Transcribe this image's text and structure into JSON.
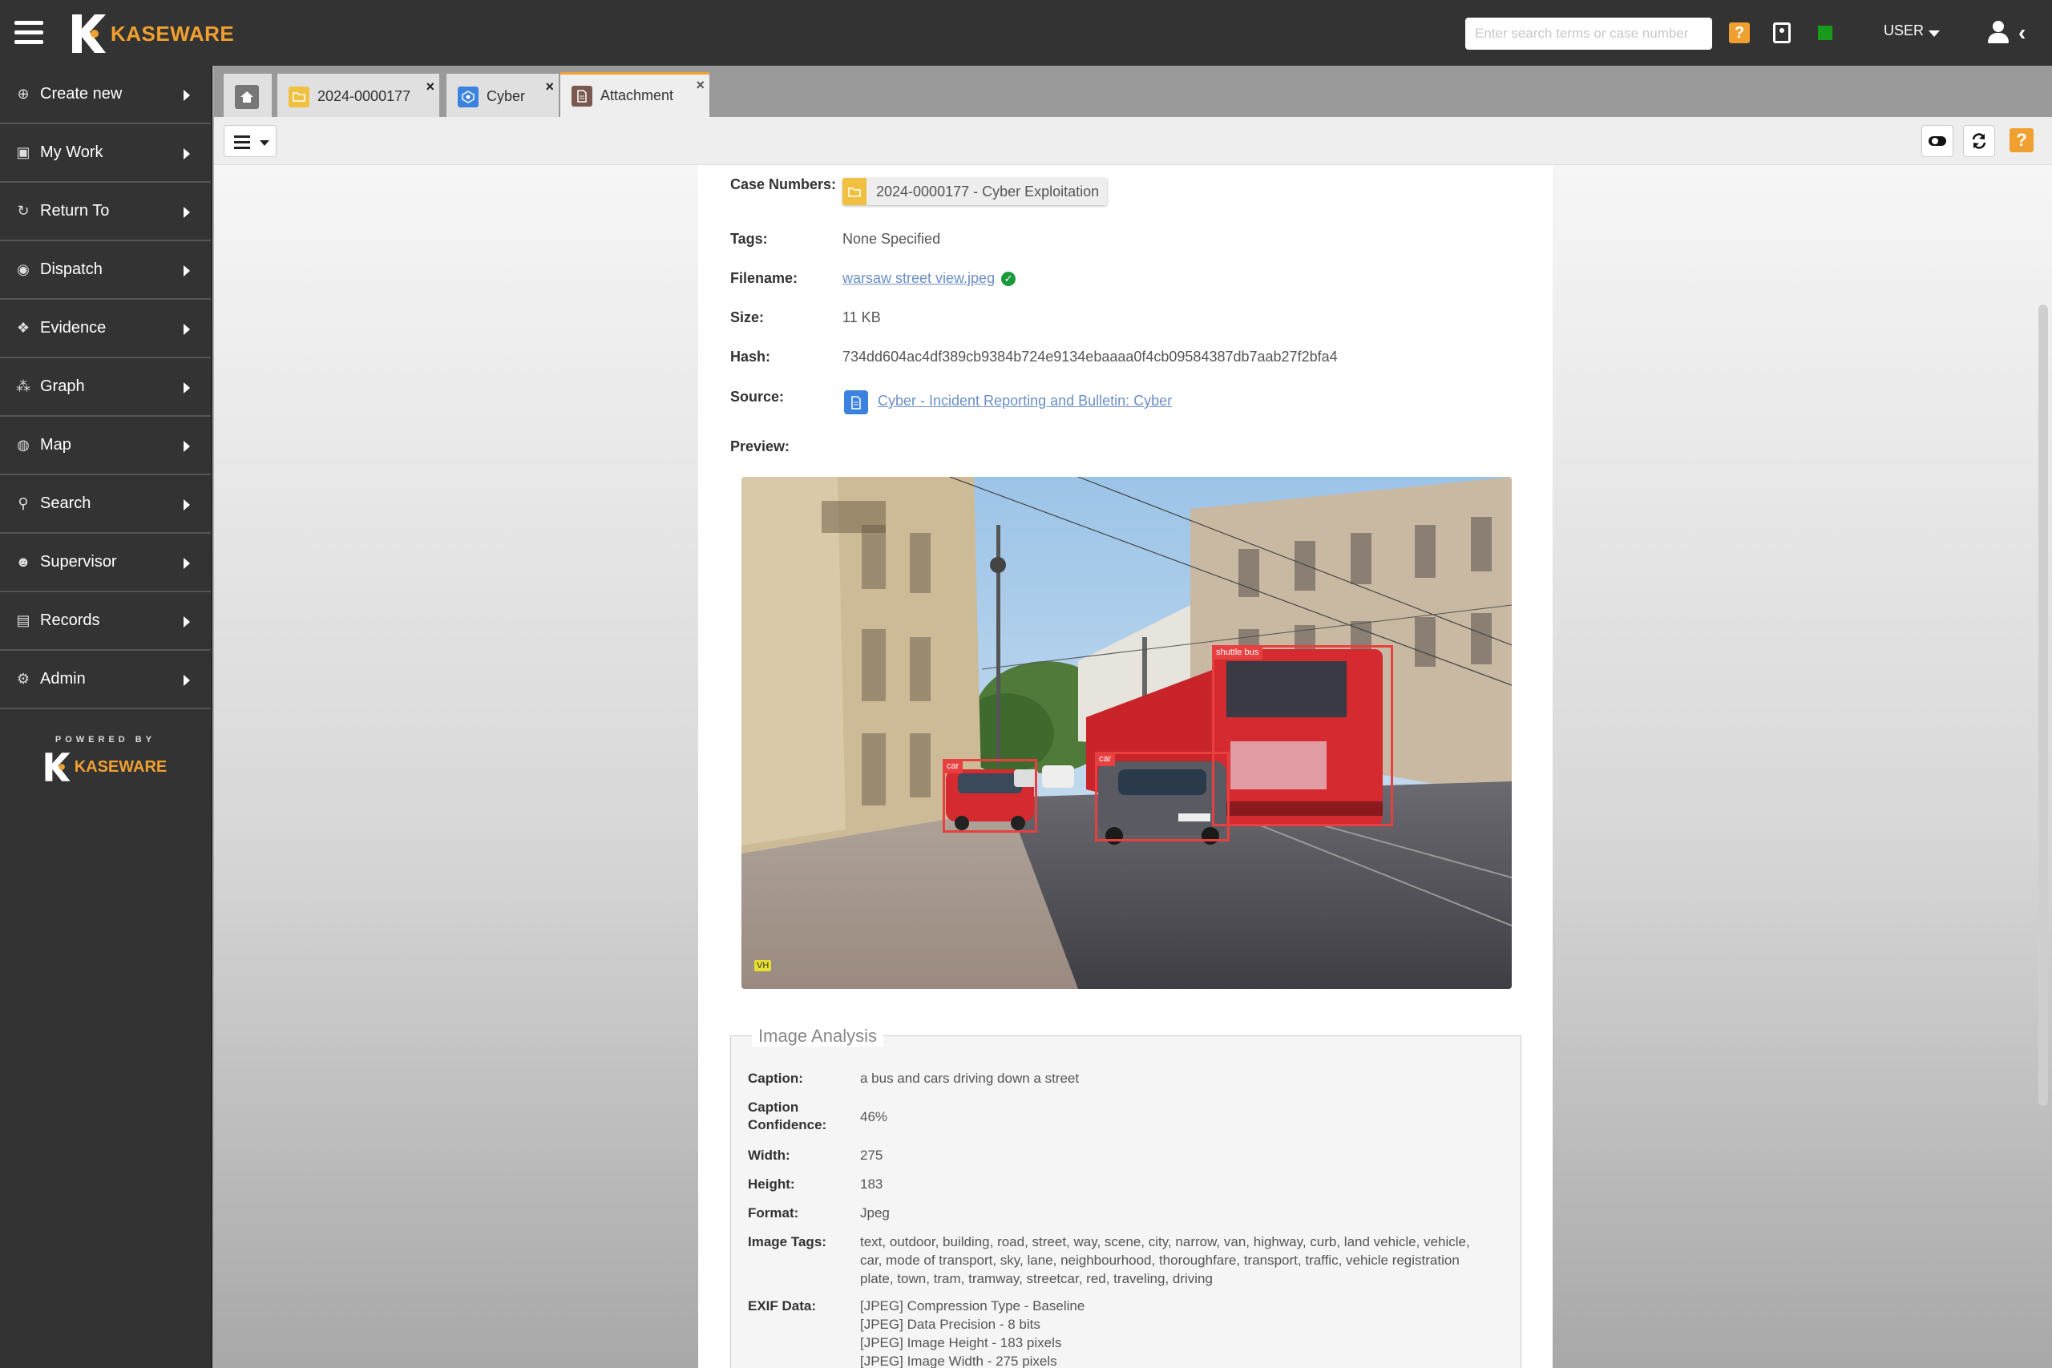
{
  "brand": {
    "name": "KASEWARE",
    "powered_by": "POWERED BY"
  },
  "topbar": {
    "search_placeholder": "Enter search terms or case number",
    "help_label": "?",
    "user_label": "USER"
  },
  "sidebar": {
    "items": [
      {
        "label": "Create new",
        "icon": "plus-circle-icon"
      },
      {
        "label": "My Work",
        "icon": "briefcase-icon"
      },
      {
        "label": "Return To",
        "icon": "refresh-icon"
      },
      {
        "label": "Dispatch",
        "icon": "podcast-icon"
      },
      {
        "label": "Evidence",
        "icon": "cubes-icon"
      },
      {
        "label": "Graph",
        "icon": "graph-icon"
      },
      {
        "label": "Map",
        "icon": "globe-icon"
      },
      {
        "label": "Search",
        "icon": "search-icon"
      },
      {
        "label": "Supervisor",
        "icon": "users-icon"
      },
      {
        "label": "Records",
        "icon": "file-icon"
      },
      {
        "label": "Admin",
        "icon": "gears-icon"
      }
    ]
  },
  "tabs": [
    {
      "label": "",
      "icon": "home-icon"
    },
    {
      "label": "2024-0000177",
      "icon": "folder-icon",
      "close": "×"
    },
    {
      "label": "Cyber",
      "icon": "cyber-icon",
      "close": "×"
    },
    {
      "label": "Attachment",
      "icon": "attachment-icon",
      "close": "×",
      "active": true
    }
  ],
  "toolbar": {
    "help_label": "?"
  },
  "details": {
    "case_numbers_label": "Case Numbers:",
    "case_number_value": "2024-0000177 - Cyber Exploitation",
    "tags_label": "Tags:",
    "tags_value": "None Specified",
    "filename_label": "Filename:",
    "filename_value": "warsaw street view.jpeg",
    "size_label": "Size:",
    "size_value": "11 KB",
    "hash_label": "Hash:",
    "hash_value": "734dd604ac4df389cb9384b724e9134ebaaaa0f4cb09584387db7aab27f2bfa4",
    "source_label": "Source:",
    "source_value": "Cyber - Incident Reporting and Bulletin: Cyber",
    "preview_label": "Preview:"
  },
  "preview": {
    "detections": [
      {
        "label": "shuttle bus"
      },
      {
        "label": "car"
      },
      {
        "label": "car"
      }
    ],
    "watermark": "VH"
  },
  "analysis": {
    "title": "Image Analysis",
    "caption_label": "Caption:",
    "caption_value": "a bus and cars driving down a street",
    "confidence_label_1": "Caption",
    "confidence_label_2": "Confidence:",
    "confidence_value": "46%",
    "width_label": "Width:",
    "width_value": "275",
    "height_label": "Height:",
    "height_value": "183",
    "format_label": "Format:",
    "format_value": "Jpeg",
    "tags_label": "Image Tags:",
    "tags_line_1": "text, outdoor, building, road, street, way, scene, city, narrow, van, highway, curb, land vehicle, vehicle,",
    "tags_line_2": "car, mode of transport, sky, lane, neighbourhood, thoroughfare, transport, traffic, vehicle registration",
    "tags_line_3": "plate, town, tram, tramway, streetcar, red, traveling, driving",
    "exif_label": "EXIF Data:",
    "exif_1": "[JPEG] Compression Type - Baseline",
    "exif_2": "[JPEG] Data Precision - 8 bits",
    "exif_3": "[JPEG] Image Height - 183 pixels",
    "exif_4": "[JPEG] Image Width - 275 pixels"
  }
}
